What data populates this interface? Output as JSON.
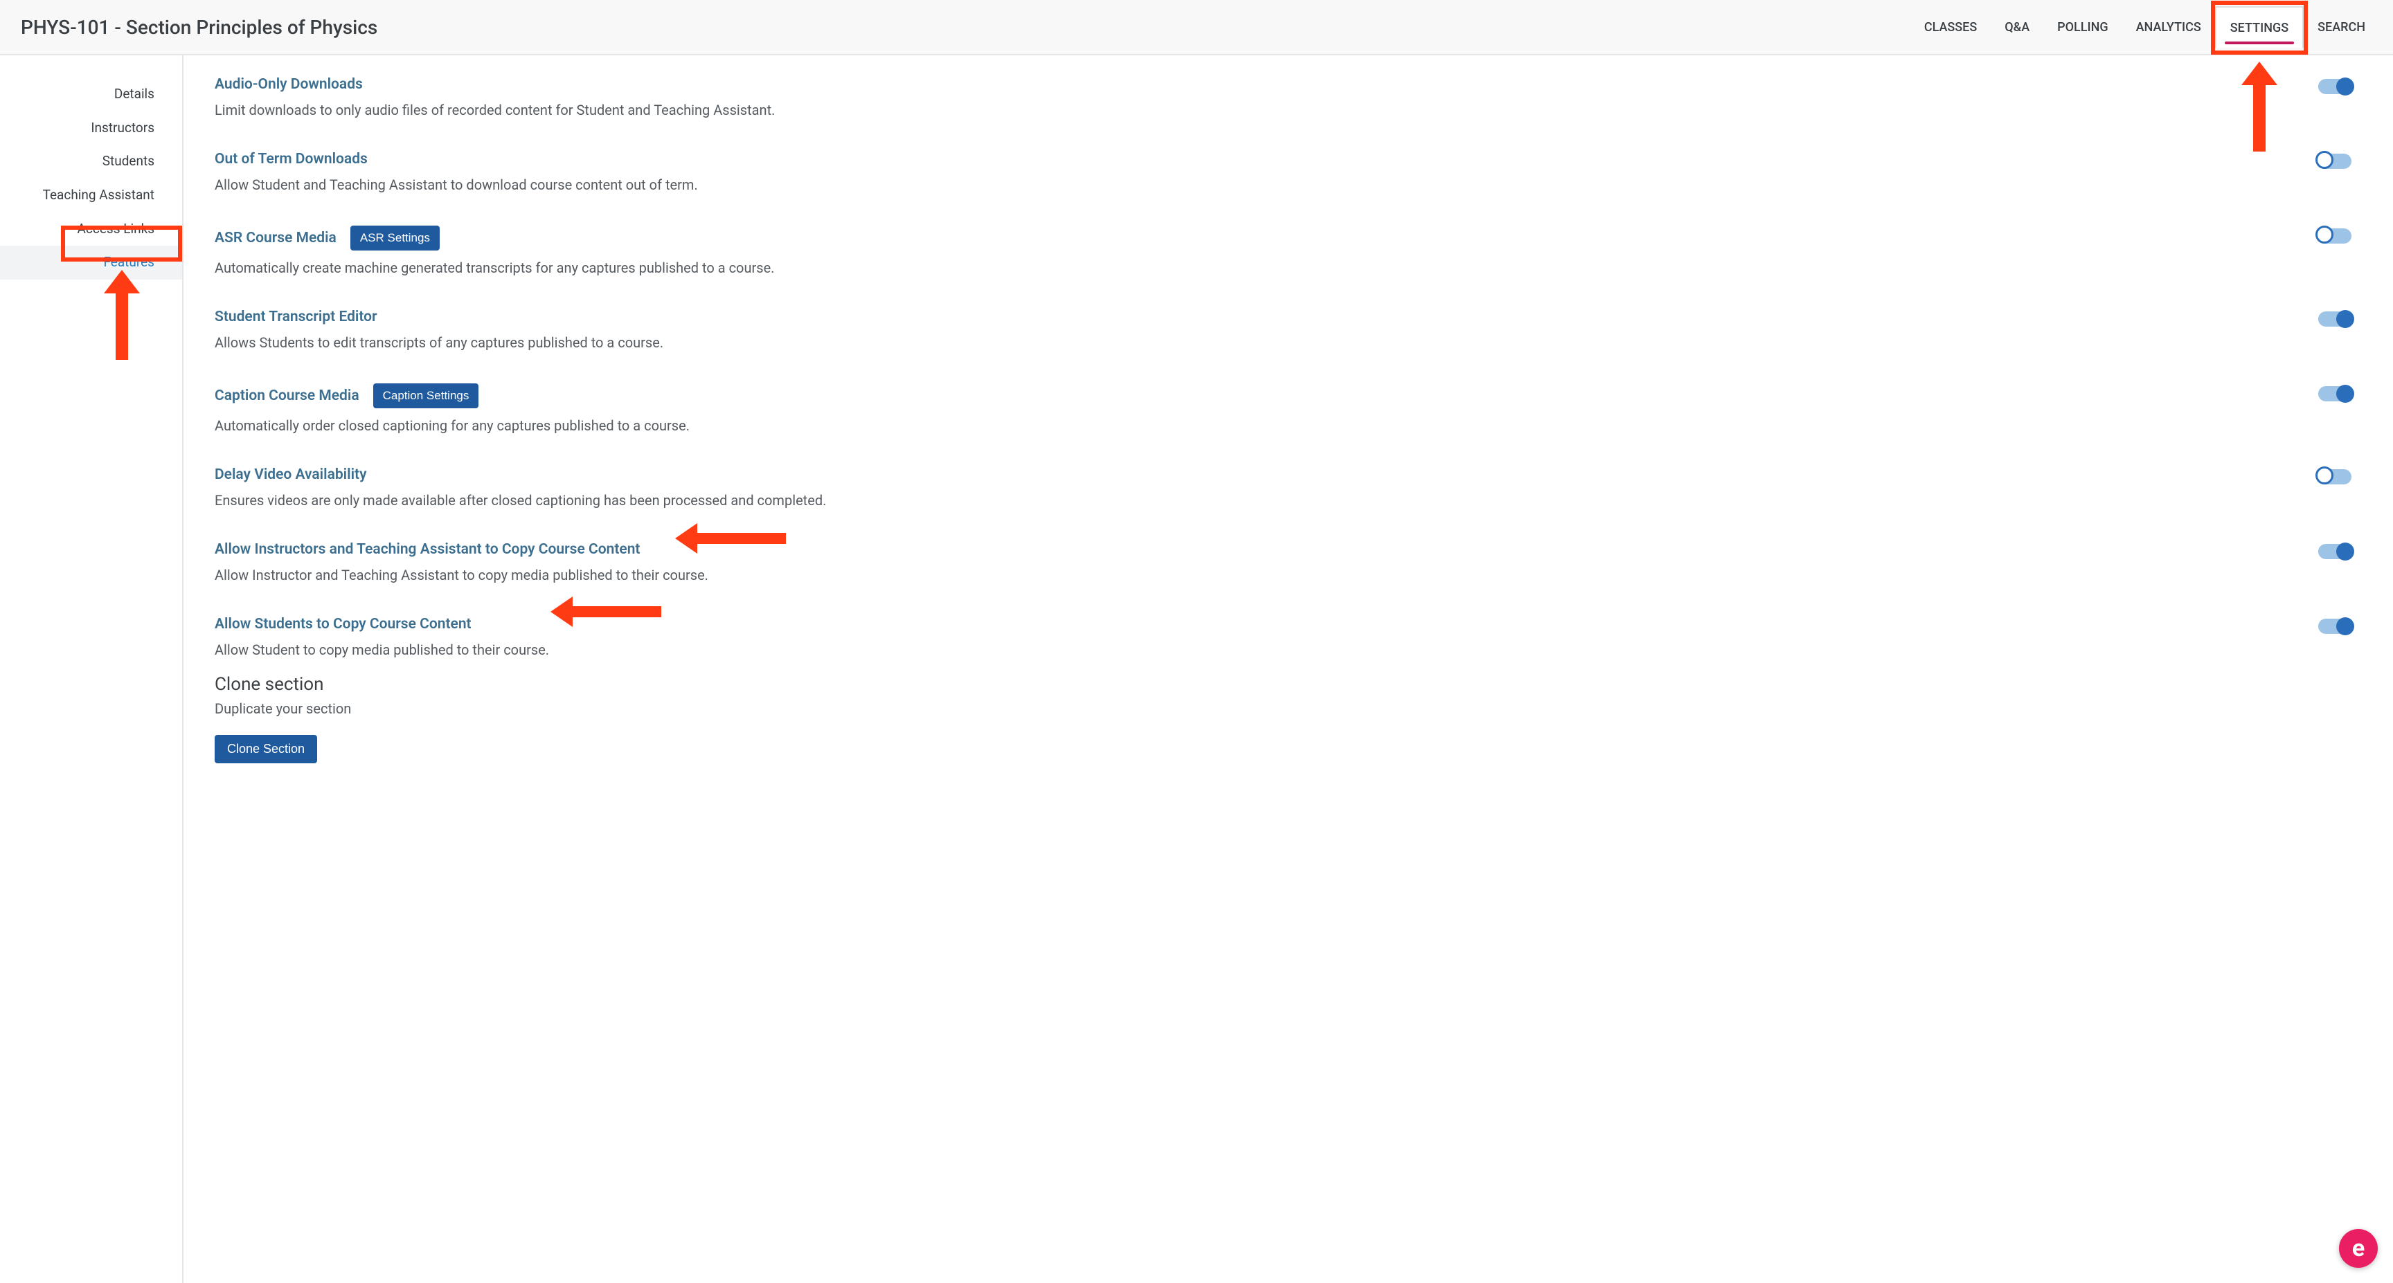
{
  "header": {
    "title": "PHYS-101 - Section Principles of Physics",
    "tabs": {
      "classes": "CLASSES",
      "qa": "Q&A",
      "polling": "POLLING",
      "analytics": "ANALYTICS",
      "settings": "SETTINGS",
      "search": "SEARCH"
    },
    "active_tab": "settings"
  },
  "sidebar": {
    "items": [
      "Details",
      "Instructors",
      "Students",
      "Teaching Assistant",
      "Access Links",
      "Features"
    ],
    "active_index": 5
  },
  "features": [
    {
      "title": "Audio-Only Downloads",
      "desc": "Limit downloads to only audio files of recorded content for Student and Teaching Assistant.",
      "toggle": "on"
    },
    {
      "title": "Out of Term Downloads",
      "desc": "Allow Student and Teaching Assistant to download course content out of term.",
      "toggle": "off"
    },
    {
      "title": "ASR Course Media",
      "button": "ASR Settings",
      "desc": "Automatically create machine generated transcripts for any captures published to a course.",
      "toggle": "off"
    },
    {
      "title": "Student Transcript Editor",
      "desc": "Allows Students to edit transcripts of any captures published to a course.",
      "toggle": "on"
    },
    {
      "title": "Caption Course Media",
      "button": "Caption Settings",
      "desc": "Automatically order closed captioning for any captures published to a course.",
      "toggle": "on"
    },
    {
      "title": "Delay Video Availability",
      "desc": "Ensures videos are only made available after closed captioning has been processed and completed.",
      "toggle": "off"
    },
    {
      "title": "Allow Instructors and Teaching Assistant to Copy Course Content",
      "desc": "Allow Instructor and Teaching Assistant to copy media published to their course.",
      "toggle": "on"
    },
    {
      "title": "Allow Students to Copy Course Content",
      "desc": "Allow Student to copy media published to their course.",
      "toggle": "on"
    }
  ],
  "clone": {
    "heading": "Clone section",
    "sub": "Duplicate your section",
    "button": "Clone Section"
  },
  "badge": "e"
}
